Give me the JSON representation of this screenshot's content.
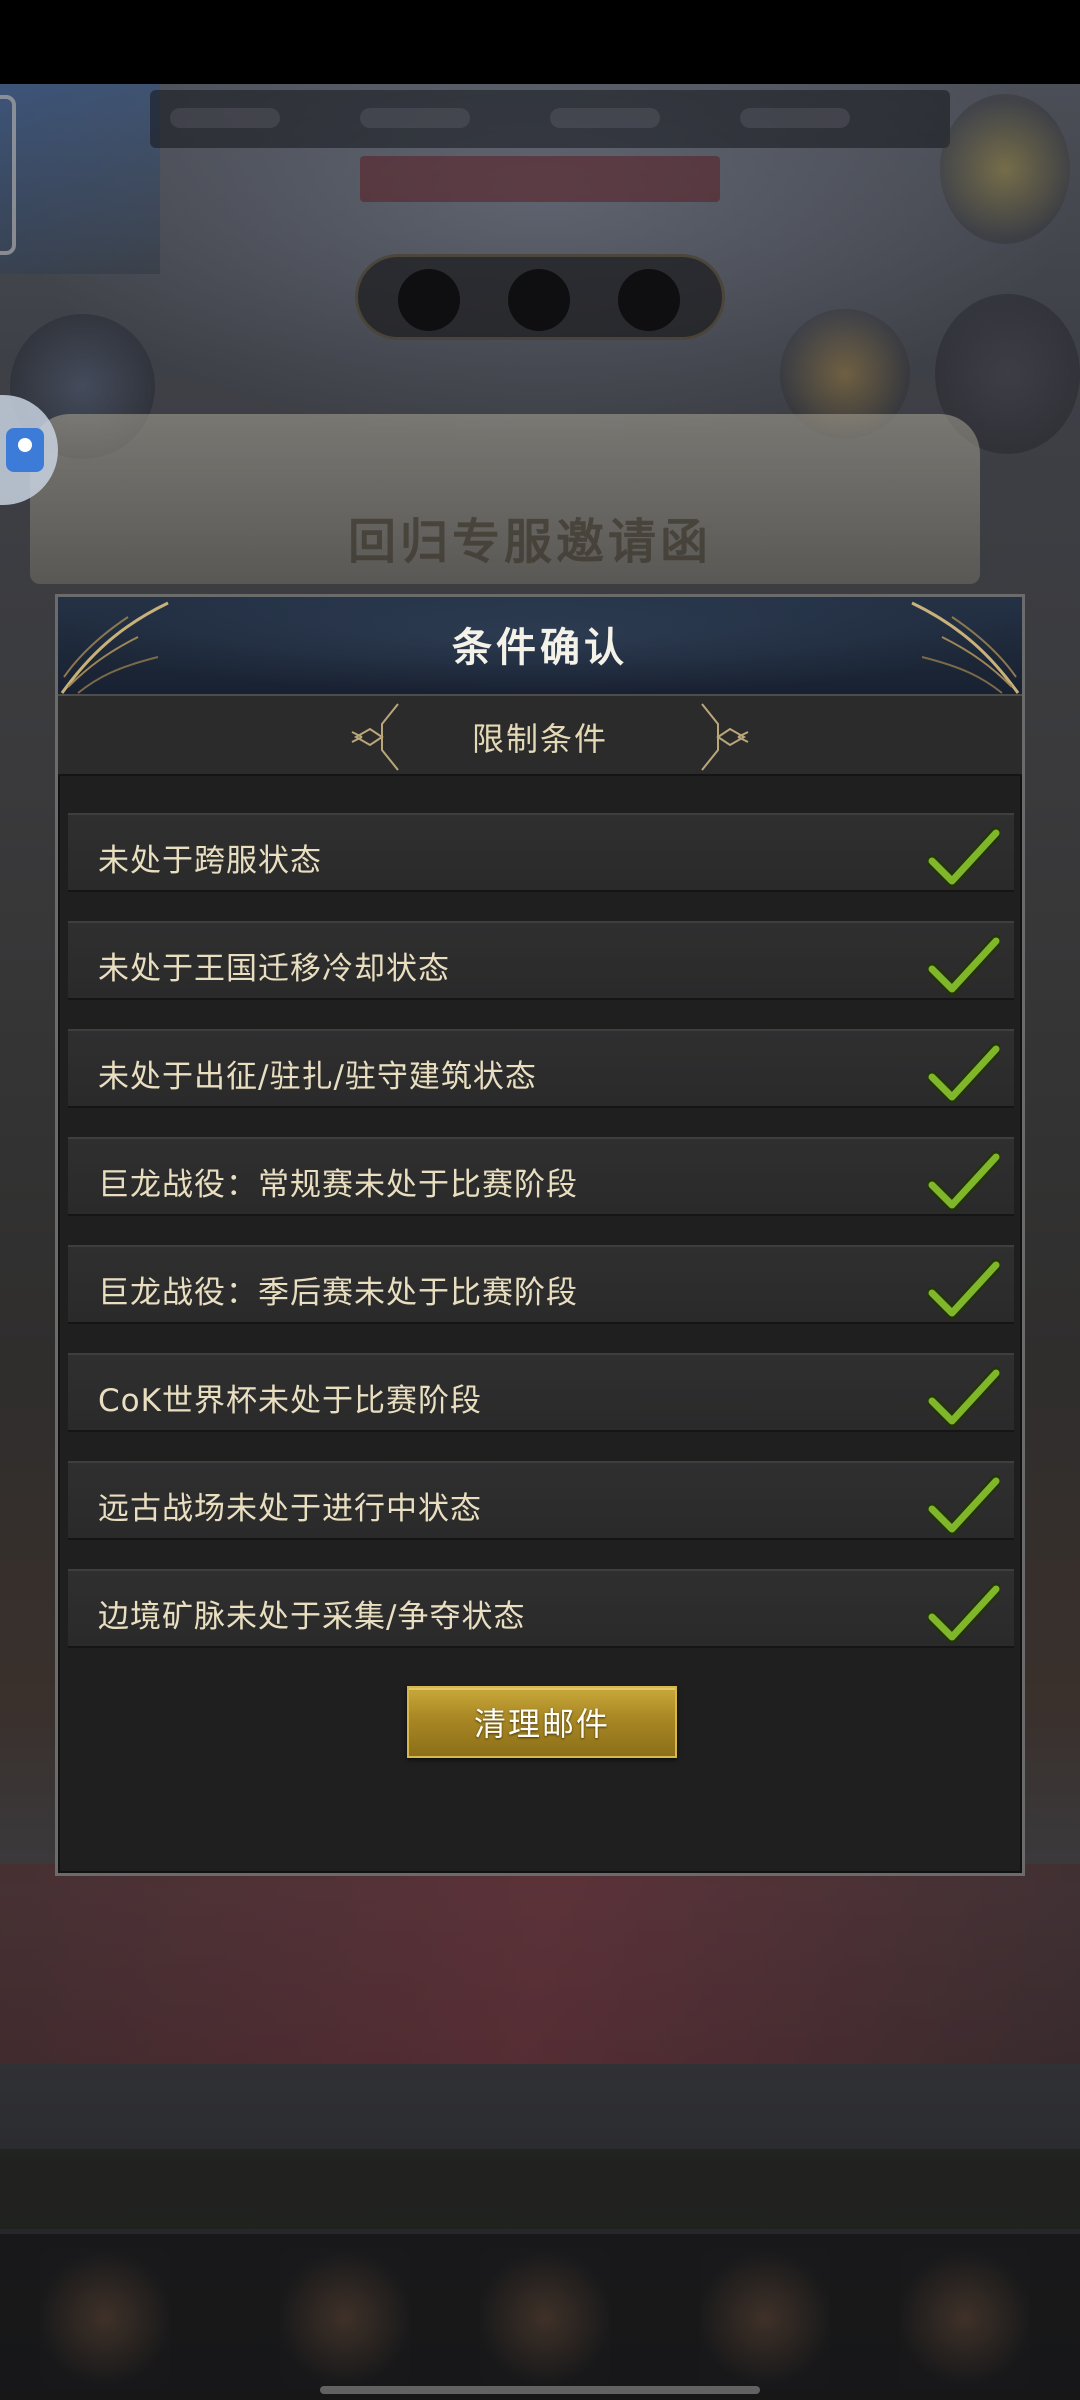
{
  "dialog": {
    "title": "条件确认",
    "subtitle": "限制条件",
    "conditions": [
      {
        "label": "未处于跨服状态",
        "met": true
      },
      {
        "label": "未处于王国迁移冷却状态",
        "met": true
      },
      {
        "label": "未处于出征/驻扎/驻守建筑状态",
        "met": true
      },
      {
        "label": "巨龙战役：常规赛未处于比赛阶段",
        "met": true
      },
      {
        "label": "巨龙战役：季后赛未处于比赛阶段",
        "met": true
      },
      {
        "label": "CoK世界杯未处于比赛阶段",
        "met": true
      },
      {
        "label": "远古战场未处于进行中状态",
        "met": true
      },
      {
        "label": "边境矿脉未处于采集/争夺状态",
        "met": true
      }
    ],
    "action_button": "清理邮件"
  },
  "background": {
    "scroll_banner": "回归专服邀请函"
  },
  "colors": {
    "check": "#7fb62a",
    "button_gold": "#a88724",
    "header_blue": "#1d2839",
    "label_text": "#e9dfc0"
  },
  "icons": {
    "check": "check-icon",
    "corner": "leaf-ornament-icon",
    "bracket": "bracket-ornament-icon",
    "floating": "screenshot-icon"
  }
}
